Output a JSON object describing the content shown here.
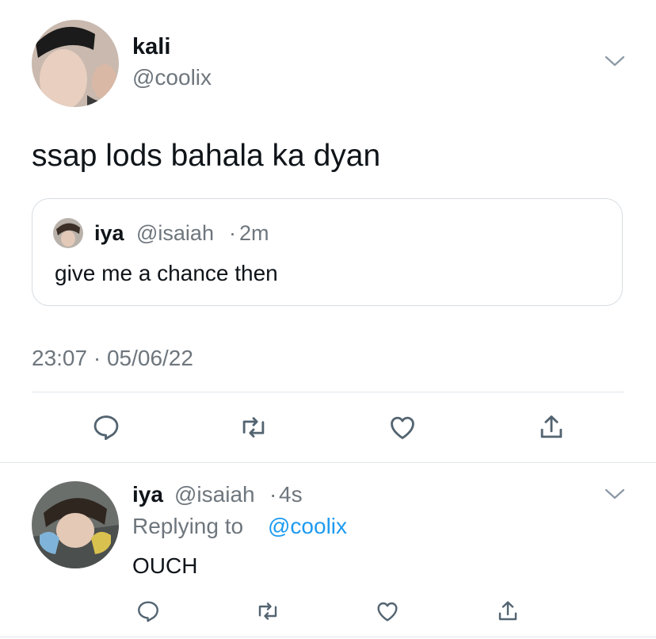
{
  "main_tweet": {
    "display_name": "kali",
    "handle": "@coolix",
    "text": "ssap lods bahala ka dyan",
    "timestamp": "23:07 · 05/06/22",
    "icons": {
      "menu": "chevron-down-icon",
      "reply": "comment-icon",
      "retweet": "retweet-icon",
      "like": "heart-icon",
      "share": "share-icon"
    }
  },
  "quoted_tweet": {
    "display_name": "iya",
    "handle": "@isaiah",
    "separator": "·",
    "time": "2m",
    "text": "give me a chance then"
  },
  "reply_tweet": {
    "display_name": "iya",
    "handle": "@isaiah",
    "separator": "·",
    "time": "4s",
    "replying_prefix": "Replying to",
    "replying_handle": "@coolix",
    "text": "OUCH"
  },
  "colors": {
    "text": "#0f1419",
    "secondary": "#6e767d",
    "accent": "#1d9bf0",
    "border": "#e1e6ea"
  }
}
